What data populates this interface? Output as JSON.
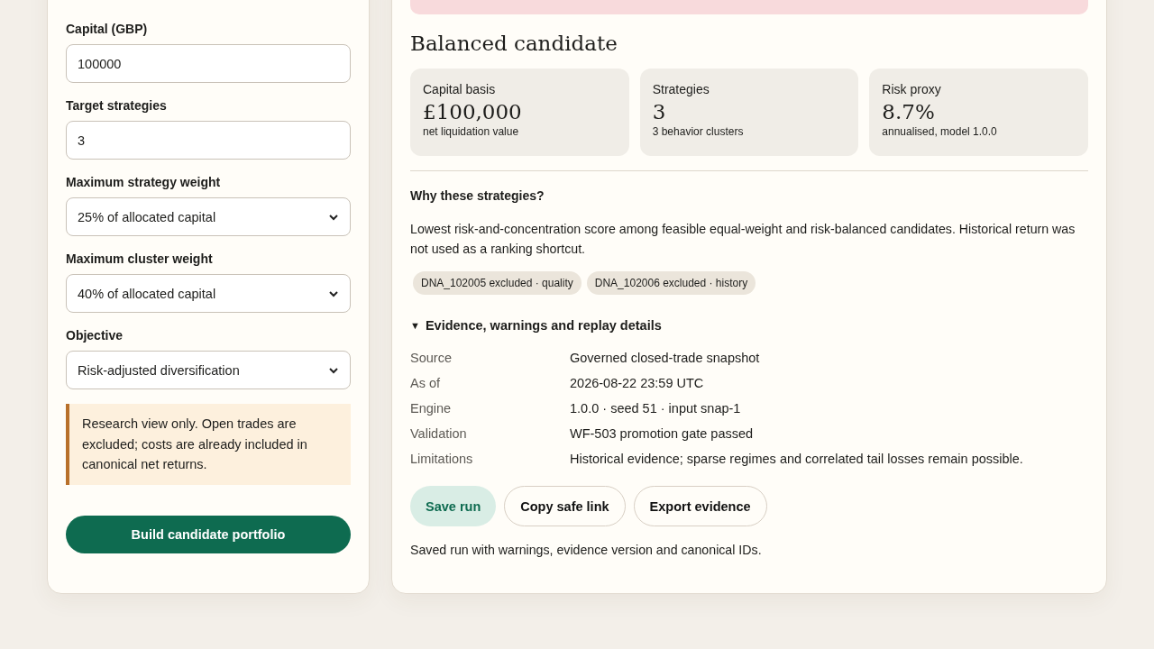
{
  "form": {
    "fields": [
      {
        "kind": "input",
        "label": "Capital (GBP)",
        "value": "100000"
      },
      {
        "kind": "input",
        "label": "Target strategies",
        "value": "3"
      },
      {
        "kind": "select",
        "label": "Maximum strategy weight",
        "value": "25% of allocated capital"
      },
      {
        "kind": "select",
        "label": "Maximum cluster weight",
        "value": "40% of allocated capital"
      },
      {
        "kind": "select",
        "label": "Objective",
        "value": "Risk-adjusted diversification"
      }
    ],
    "notice": "Research view only. Open trades are excluded; costs are already included in canonical net returns.",
    "submit": "Build candidate portfolio"
  },
  "result": {
    "alert": {
      "kind": "error"
    },
    "title": "Balanced candidate",
    "stats": [
      {
        "label": "Capital basis",
        "value": "£100,000",
        "note": "net liquidation value"
      },
      {
        "label": "Strategies",
        "value": "3",
        "note": "3 behavior clusters"
      },
      {
        "label": "Risk proxy",
        "value": "8.7%",
        "note": "annualised, model 1.0.0"
      }
    ],
    "why_heading": "Why these strategies?",
    "why_text": "Lowest risk-and-concentration score among feasible equal-weight and risk-balanced candidates. Historical return was not used as a ranking shortcut.",
    "tags": [
      "DNA_102005 excluded · quality",
      "DNA_102006 excluded · history"
    ],
    "details": {
      "toggle": "▼",
      "summary": "Evidence, warnings and replay details",
      "expanded": true,
      "rows": [
        {
          "label": "Source",
          "value": "Governed closed-trade snapshot"
        },
        {
          "label": "As of",
          "value": "2026-08-22 23:59 UTC"
        },
        {
          "label": "Engine",
          "value": "1.0.0 · seed 51 · input snap-1"
        },
        {
          "label": "Validation",
          "value": "WF-503 promotion gate passed"
        },
        {
          "label": "Limitations",
          "value": "Historical evidence; sparse regimes and correlated tail losses remain possible."
        }
      ]
    },
    "actions": [
      {
        "label": "Save run",
        "kind": "primary"
      },
      {
        "label": "Copy safe link",
        "kind": "secondary"
      },
      {
        "label": "Export evidence",
        "kind": "secondary"
      }
    ],
    "status": "Saved run with warnings, evidence version and canonical IDs."
  }
}
